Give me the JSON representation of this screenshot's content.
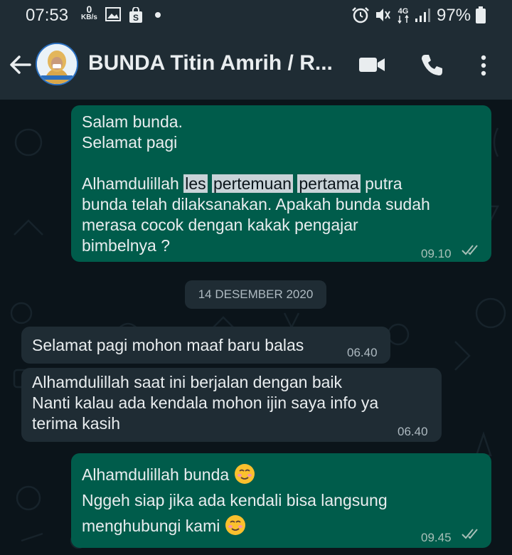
{
  "status_bar": {
    "time": "07:53",
    "net_speed_value": "0",
    "net_speed_unit": "KB/s",
    "battery_percent": "97%",
    "network": "4G"
  },
  "chat_header": {
    "contact_name": "BUNDA Titin Amrih / R..."
  },
  "messages": [
    {
      "direction": "outgoing",
      "greeting": "Salam bunda.\nSelamat pagi",
      "body_start": "Alhamdulillah ",
      "highlight_1": "les",
      "highlight_2": "pertemuan",
      "highlight_3": "pertama",
      "body_rest": " putra\nbunda telah dilaksanakan. Apakah bunda sudah\nmerasa cocok dengan kakak pengajar\nbimbelnya ?",
      "time": "09.10"
    },
    {
      "direction": "incoming",
      "text": "Selamat pagi mohon maaf baru balas",
      "time": "06.40"
    },
    {
      "direction": "incoming",
      "text": "Alhamdulillah saat ini berjalan dengan baik\nNanti kalau ada kendala mohon ijin saya info ya\nterima kasih",
      "time": "06.40"
    },
    {
      "direction": "outgoing",
      "line1": "Alhamdulillah bunda",
      "line2": "Nggeh siap jika ada kendali bisa langsung",
      "line3": "menghubungi kami",
      "time": "09.45"
    }
  ],
  "date_separator": "14 DESEMBER 2020",
  "colors": {
    "outgoing_bubble": "#005c4b",
    "incoming_bubble": "#1f2c34",
    "background": "#0b141a",
    "read_ticks": "#a8c0b8"
  }
}
